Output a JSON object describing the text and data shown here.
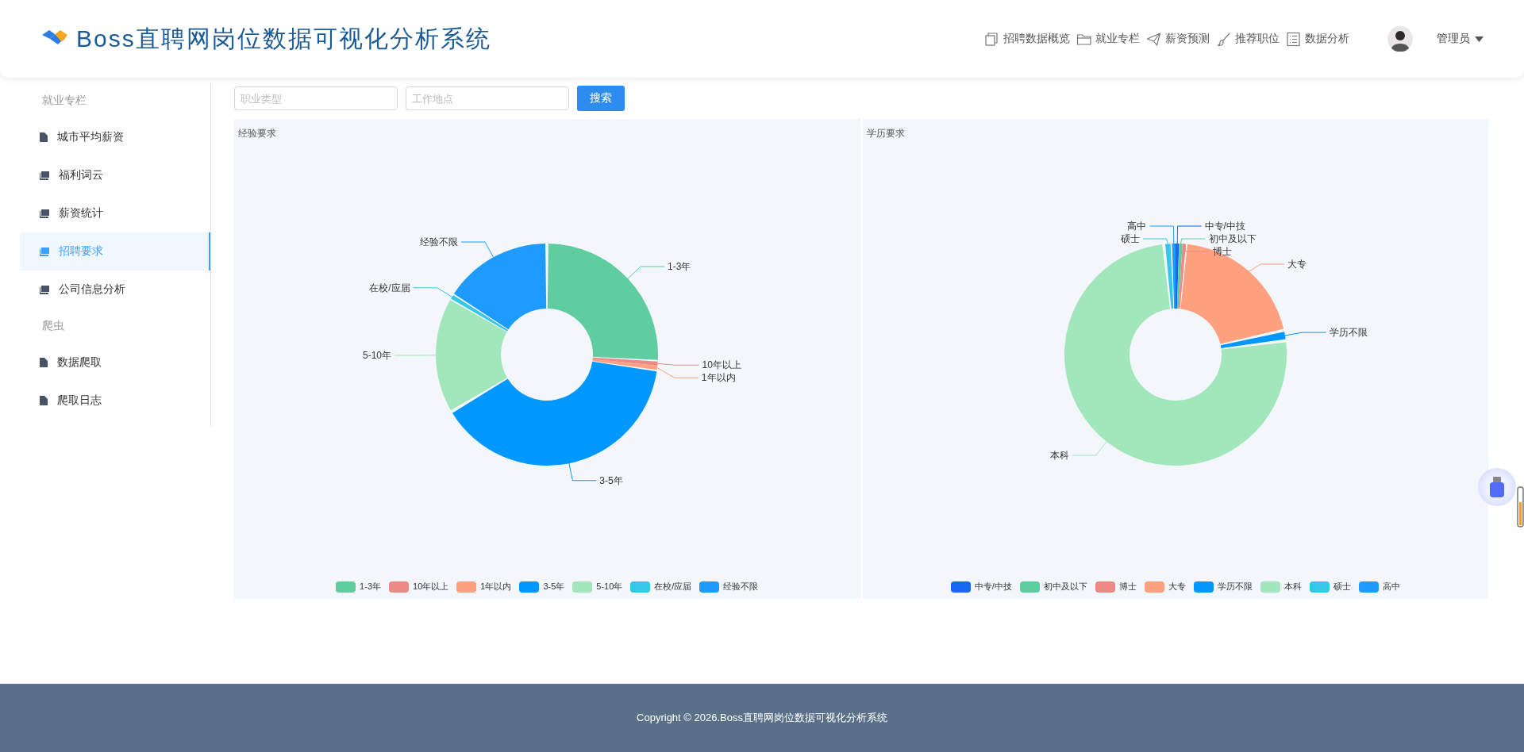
{
  "header": {
    "title": "Boss直聘网岗位数据可视化分析系统",
    "nav": [
      {
        "label": "招聘数据概览"
      },
      {
        "label": "就业专栏"
      },
      {
        "label": "薪资预测"
      },
      {
        "label": "推荐职位"
      },
      {
        "label": "数据分析"
      }
    ],
    "user": {
      "name": "管理员"
    }
  },
  "sidebar": {
    "groups": [
      {
        "title": "就业专栏",
        "items": [
          {
            "label": "城市平均薪资",
            "selected": false
          },
          {
            "label": "福利词云",
            "selected": false
          },
          {
            "label": "薪资统计",
            "selected": false
          },
          {
            "label": "招聘要求",
            "selected": true
          },
          {
            "label": "公司信息分析",
            "selected": false
          }
        ]
      },
      {
        "title": "爬虫",
        "items": [
          {
            "label": "数据爬取",
            "selected": false
          },
          {
            "label": "爬取日志",
            "selected": false
          }
        ]
      }
    ]
  },
  "filters": {
    "fields": [
      {
        "placeholder": "职业类型"
      },
      {
        "placeholder": "工作地点"
      }
    ],
    "search_button": "搜索"
  },
  "charts": [
    {
      "title": "经验要求",
      "chart_data": {
        "type": "donut",
        "categories": [
          "1-3年",
          "10年以上",
          "1年以内",
          "3-5年",
          "5-10年",
          "在校/应届",
          "经验不限"
        ],
        "values": [
          26,
          0.6,
          0.6,
          39.2,
          17,
          0.6,
          16
        ],
        "colors": [
          "#5fcda0",
          "#ee8a86",
          "#ffa07f",
          "#0097ff",
          "#a2e6bb",
          "#36c6e8",
          "#1e9bfe"
        ]
      }
    },
    {
      "title": "学历要求",
      "chart_data": {
        "type": "donut",
        "categories": [
          "中专/中技",
          "初中及以下",
          "博士",
          "大专",
          "学历不限",
          "本科",
          "硕士",
          "高中"
        ],
        "values": [
          0.5,
          0.5,
          0.5,
          20,
          1.5,
          75.3,
          1.2,
          0.5
        ],
        "colors": [
          "#1767f0",
          "#5fcda0",
          "#ee8a86",
          "#ffa07f",
          "#0097ff",
          "#a2e6bb",
          "#36c6e8",
          "#1e9bfe"
        ]
      }
    }
  ],
  "footer": "Copyright © 2026.Boss直聘网岗位数据可视化分析系统"
}
